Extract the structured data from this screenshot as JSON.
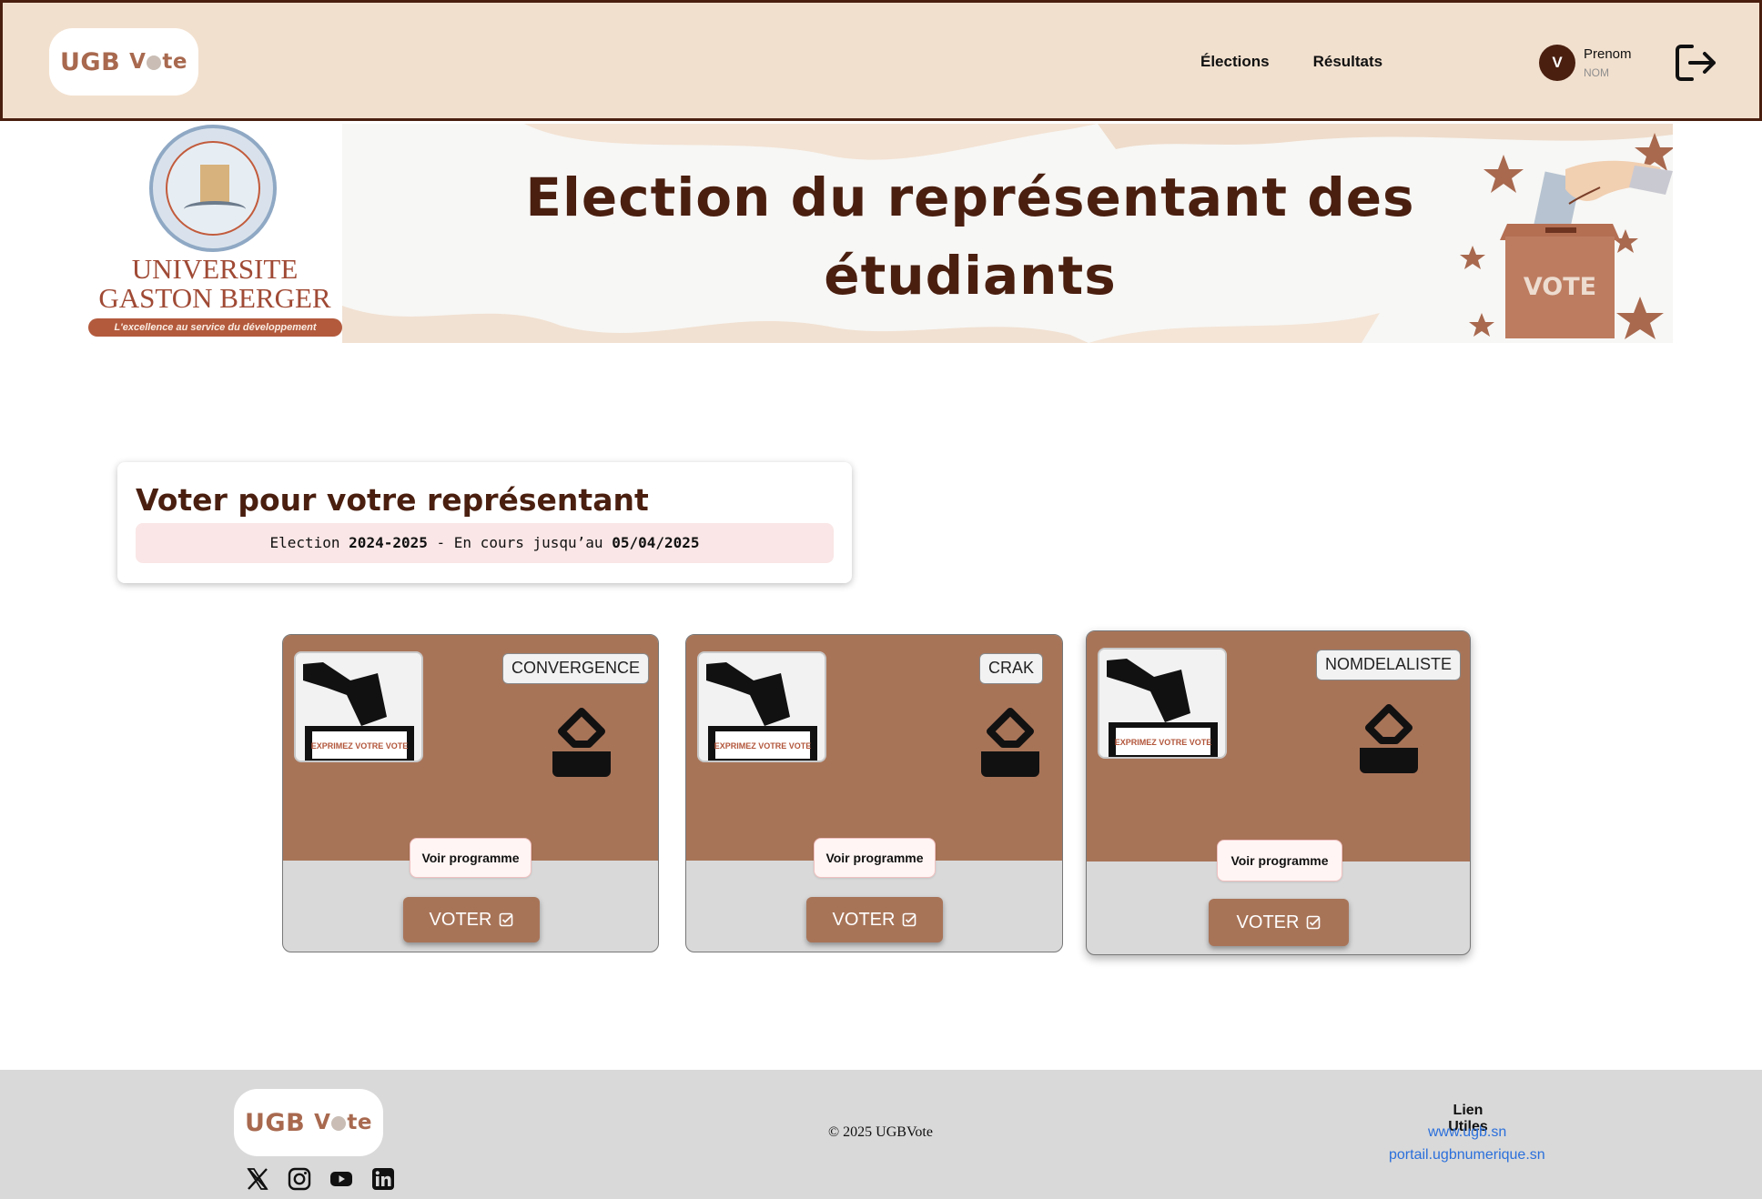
{
  "header": {
    "logo": {
      "prefix": "UGB",
      "word_start": "V",
      "word_end": "te"
    },
    "nav": [
      {
        "label": "Élections"
      },
      {
        "label": "Résultats"
      }
    ],
    "user": {
      "initial": "V",
      "first_name": "Prenom",
      "last_name": "NOM"
    },
    "logout_icon": "logout-icon"
  },
  "banner": {
    "title": "Election du représentant des étudiants",
    "university_logo": {
      "line1": "UNIVERSITE",
      "line2": "GASTON BERGER",
      "motto": "L'excellence au service du développement",
      "seal_text": "UNIVERSITE GASTON BERGER SAINT-LOUIS DU SENEGAL"
    },
    "ballot_box_label": "VOTE"
  },
  "vote_panel": {
    "title": "Voter pour votre représentant",
    "subtitle_prefix": "Election",
    "year": "2024-2025",
    "subtitle_middle": "- En cours jusqu’au",
    "end_date": "05/04/2025"
  },
  "candidates": [
    {
      "list_name": "CONVERGENCE",
      "photo_caption": "EXPRIMEZ VOTRE VOTE",
      "program_label": "Voir programme",
      "vote_label": "VOTER"
    },
    {
      "list_name": "CRAK",
      "photo_caption": "EXPRIMEZ VOTRE VOTE",
      "program_label": "Voir programme",
      "vote_label": "VOTER"
    },
    {
      "list_name": "NOMDELALISTE",
      "photo_caption": "EXPRIMEZ VOTRE VOTE",
      "program_label": "Voir programme",
      "vote_label": "VOTER"
    }
  ],
  "footer": {
    "logo": {
      "prefix": "UGB",
      "word_start": "V",
      "word_end": "te"
    },
    "socials": [
      "x-icon",
      "instagram-icon",
      "youtube-icon",
      "linkedin-icon"
    ],
    "copyright": "© 2025 UGBVote",
    "links_title": "Lien Utiles",
    "links": [
      {
        "label": "www.ugb.sn"
      },
      {
        "label": "portail.ugbnumerique.sn"
      }
    ]
  },
  "colors": {
    "header_bg": "#f2e0ce",
    "dark_brown": "#4a1f10",
    "accent_brown": "#a87458",
    "link_blue": "#2a6fdb"
  }
}
